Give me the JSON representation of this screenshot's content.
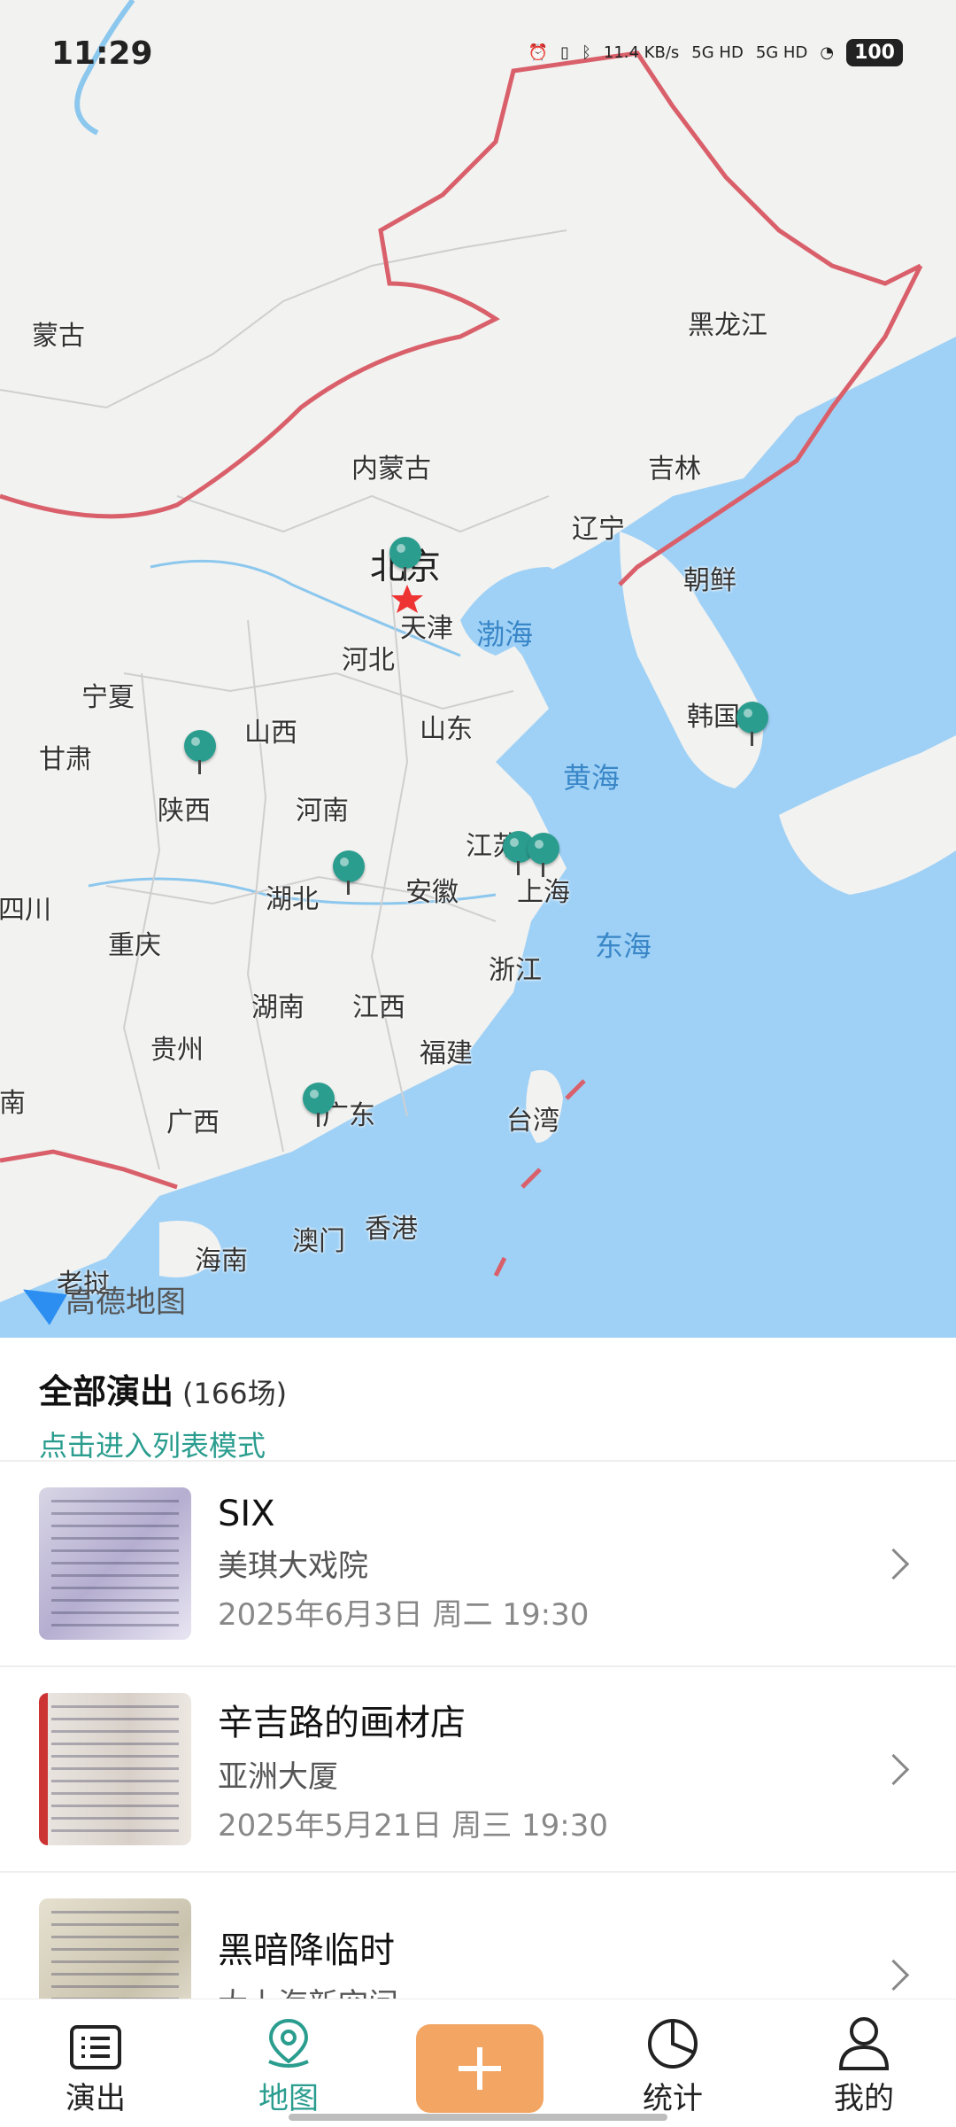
{
  "status_bar": {
    "time": "11:29",
    "net_speed": "11.4 KB/s",
    "sim1": "5G HD",
    "sim2": "5G HD",
    "battery": "100"
  },
  "map": {
    "provider_logo": "高德地图",
    "labels": {
      "mongolia": "蒙古",
      "heilongjiang": "黑龙江",
      "neimenggu": "内蒙古",
      "jilin": "吉林",
      "liaoning": "辽宁",
      "beijing": "北京",
      "tianjin": "天津",
      "hebei": "河北",
      "bohai": "渤海",
      "chaoxian": "朝鲜",
      "hanguo": "韩国",
      "ningxia": "宁夏",
      "gansu": "甘肃",
      "shanxi": "山西",
      "shandong": "山东",
      "huanghai": "黄海",
      "shaanxi": "陕西",
      "henan": "河南",
      "jiangsu": "江苏",
      "sichuan": "四川",
      "hubei": "湖北",
      "anhui": "安徽",
      "shanghai": "上海",
      "donghai": "东海",
      "chongqing": "重庆",
      "zhejiang": "浙江",
      "hunan": "湖南",
      "jiangxi": "江西",
      "guizhou": "贵州",
      "fujian": "福建",
      "yunnan": "南",
      "guangxi": "广西",
      "guangdong": "广东",
      "taiwan": "台湾",
      "xianggang": "香港",
      "aomen": "澳门",
      "hainan": "海南",
      "laos": "老挝"
    }
  },
  "sheet": {
    "title": "全部演出",
    "count": "(166场)",
    "list_mode_link": "点击进入列表模式",
    "shows": [
      {
        "title": "SIX",
        "venue": "美琪大戏院",
        "datetime": "2025年6月3日 周二 19:30"
      },
      {
        "title": "辛吉路的画材店",
        "venue": "亚洲大厦",
        "datetime": "2025年5月21日 周三 19:30"
      },
      {
        "title": "黑暗降临时",
        "venue": "大上海新空间",
        "datetime": ""
      }
    ]
  },
  "tabbar": {
    "items": [
      {
        "label": "演出",
        "icon": "list-icon"
      },
      {
        "label": "地图",
        "icon": "map-pin-icon"
      },
      {
        "label": "",
        "icon": "plus-icon"
      },
      {
        "label": "统计",
        "icon": "pie-chart-icon"
      },
      {
        "label": "我的",
        "icon": "person-icon"
      }
    ],
    "active": "地图",
    "colors": {
      "accent": "#2a9d8f",
      "add_button": "#f3a663"
    }
  }
}
